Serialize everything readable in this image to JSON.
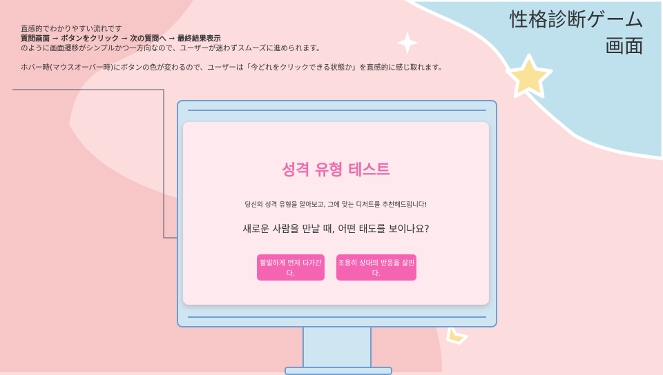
{
  "page_title": {
    "line1": "性格診断ゲーム",
    "line2": "画面"
  },
  "notes": {
    "line1": "直感的でわかりやすい流れです",
    "flow": "質問画面 → ボタンをクリック → 次の質問へ → 最終結果表示",
    "line3": "のように画面遷移がシンプルかつ一方向なので、ユーザーが迷わずスムーズに進められます。",
    "line4": "ホバー時(マウスオーバー時)にボタンの色が変わるので、ユーザーは「今どれをクリックできる状態か」を直感的に感じ取れます。"
  },
  "app": {
    "title": "성격 유형 테스트",
    "subtitle": "당신의 성격 유형을 알아보고, 그에 맞는 디저트를 추천해드립니다!",
    "question": "새로운 사람을 만날 때, 어떤 태도를 보이나요?",
    "answers": [
      "활발하게 먼저 다가간다.",
      "조용히 상대의 반응을 살핀다."
    ]
  },
  "colors": {
    "background": "#fcdcdc",
    "blob_pink": "#f7c6c6",
    "corner_blue": "#bfe1ee",
    "accent_pink": "#f564b2",
    "title_pink": "#f06aa8",
    "monitor_blue": "#6d9fd4",
    "star_yellow": "#fbe29a"
  }
}
